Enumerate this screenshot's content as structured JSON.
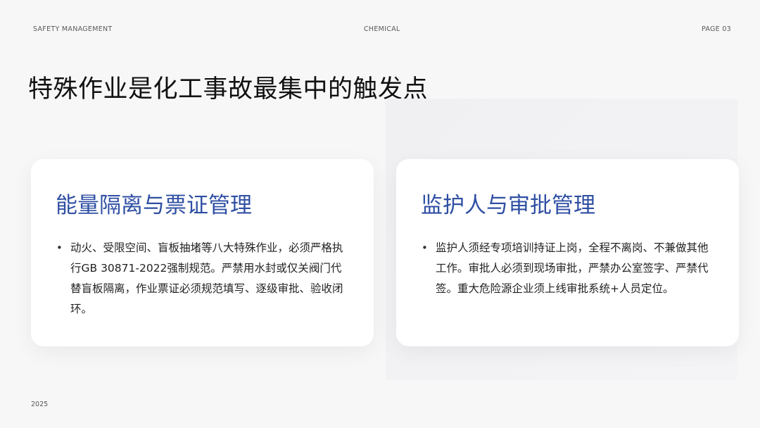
{
  "header": {
    "left": "SAFETY MANAGEMENT",
    "center": "CHEMICAL",
    "right": "PAGE 03"
  },
  "title": "特殊作业是化工事故最集中的触发点",
  "cards": [
    {
      "heading": "能量隔离与票证管理",
      "bullet": "动火、受限空间、盲板抽堵等八大特殊作业，必须严格执行GB 30871-2022强制规范。严禁用水封或仅关阀门代替盲板隔离，作业票证必须规范填写、逐级审批、验收闭环。"
    },
    {
      "heading": "监护人与审批管理",
      "bullet": "监护人须经专项培训持证上岗，全程不离岗、不兼做其他工作。审批人必须到现场审批，严禁办公室签字、严禁代签。重大危险源企业须上线审批系统+人员定位。"
    }
  ],
  "footer": {
    "year": "2025"
  },
  "icons": {
    "bullet": "bullet-dot-icon"
  },
  "colors": {
    "accent": "#2f4fa3",
    "background": "#f7f7f8",
    "card": "#ffffff"
  }
}
